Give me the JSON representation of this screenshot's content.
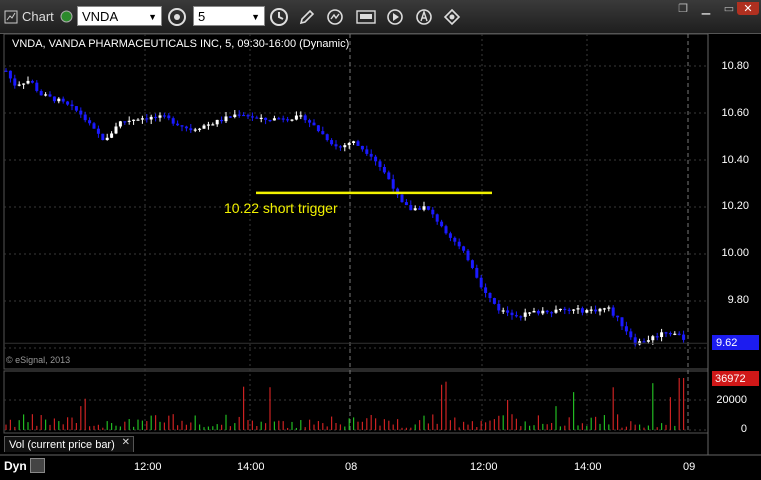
{
  "toolbar": {
    "window_label": "Chart",
    "symbol": "VNDA",
    "interval": "5"
  },
  "chart": {
    "title": "VNDA, VANDA PHARMACEUTICALS INC, 5, 09:30-16:00 (Dynamic)",
    "copyright": "© eSignal, 2013",
    "last_price": "9.62",
    "price_axis": [
      "10.80",
      "10.60",
      "10.40",
      "10.20",
      "10.00",
      "9.80"
    ],
    "annotation": "10.22 short trigger",
    "annotation_price": 10.26,
    "colors": {
      "up": "#ffffff",
      "down": "#1a1aff",
      "annotation": "#f2f200",
      "vol_up": "#22bb22",
      "vol_down": "#cc2222"
    }
  },
  "volume": {
    "label": "Vol (current price bar)",
    "last_volume": "36972",
    "axis": [
      "20000",
      "0"
    ]
  },
  "time_axis": [
    "12:00",
    "14:00",
    "08",
    "12:00",
    "14:00",
    "09"
  ],
  "footer": {
    "mode": "Dyn"
  }
}
